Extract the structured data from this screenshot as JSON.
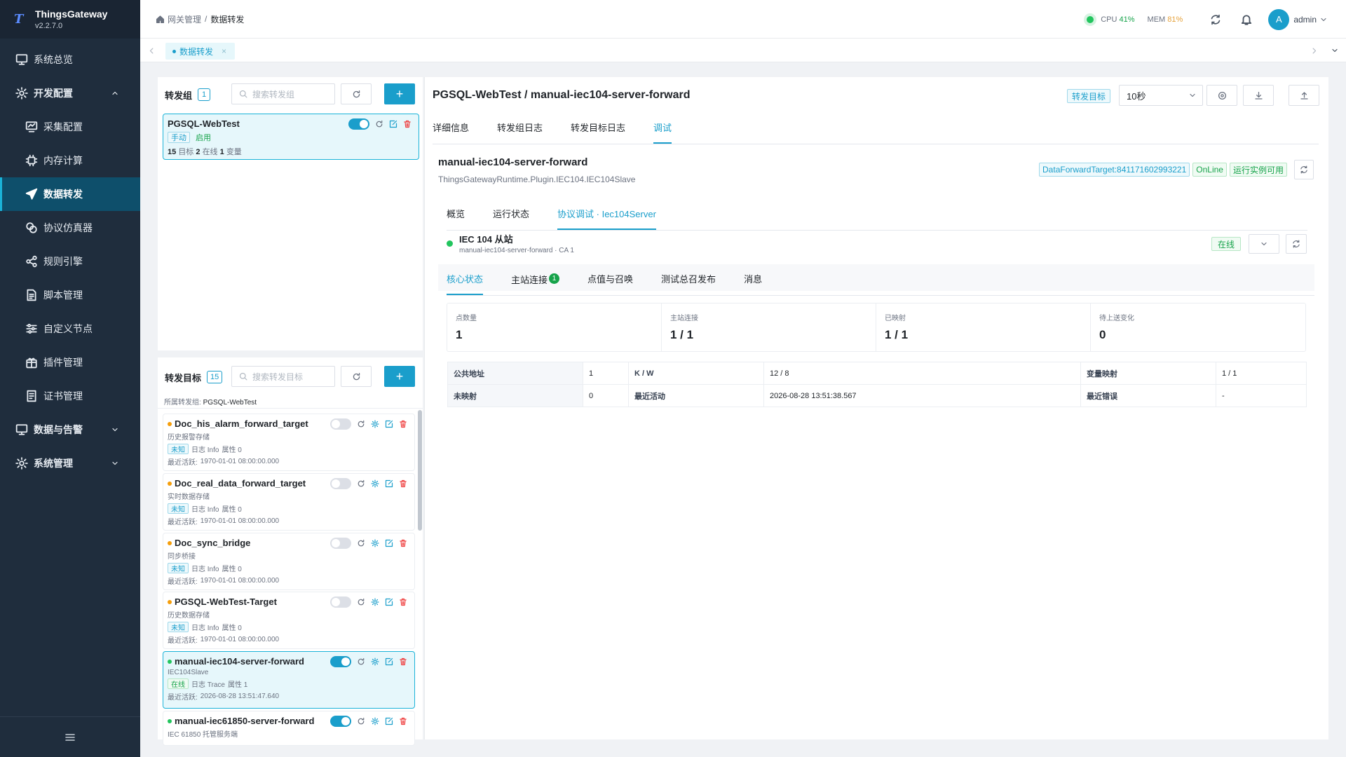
{
  "app": {
    "logo": "T",
    "name": "ThingsGateway",
    "version": "v2.2.7.0"
  },
  "sidebar": {
    "items": [
      {
        "label": "系统总览"
      },
      {
        "label": "开发配置"
      },
      {
        "label": "采集配置"
      },
      {
        "label": "内存计算"
      },
      {
        "label": "数据转发"
      },
      {
        "label": "协议仿真器"
      },
      {
        "label": "规则引擎"
      },
      {
        "label": "脚本管理"
      },
      {
        "label": "自定义节点"
      },
      {
        "label": "插件管理"
      },
      {
        "label": "证书管理"
      },
      {
        "label": "数据与告警"
      },
      {
        "label": "系统管理"
      }
    ]
  },
  "header": {
    "breadcrumb": [
      "网关管理",
      "数据转发"
    ],
    "cpu_label": "CPU",
    "cpu_value": "41%",
    "mem_label": "MEM",
    "mem_value": "81%",
    "user_initial": "A",
    "user_name": "admin"
  },
  "tabs": [
    {
      "label": "数据转发",
      "close": "×"
    }
  ],
  "groups": {
    "title": "转发组",
    "count": "1",
    "search_placeholder": "搜索转发组",
    "add_label": "+",
    "card": {
      "name": "PGSQL-WebTest",
      "mode": "手动",
      "state": "启用",
      "s_targets": "15",
      "s_targets_label": "目标",
      "s_online": "2",
      "s_online_label": "在线",
      "s_vars": "1",
      "s_vars_label": "变量"
    }
  },
  "targets": {
    "title": "转发目标",
    "count": "15",
    "search_placeholder": "搜索转发目标",
    "add_label": "+",
    "group_label": "所属转发组:",
    "group_value": "PGSQL-WebTest",
    "items": [
      {
        "name": "Doc_his_alarm_forward_target",
        "desc": "历史报警存储",
        "status": "未知",
        "log": "日志 Info",
        "attr": "属性 0",
        "active_label": "最近活跃:",
        "active": "1970-01-01 08:00:00.000",
        "dot": "#f59e0b"
      },
      {
        "name": "Doc_real_data_forward_target",
        "desc": "实时数据存储",
        "status": "未知",
        "log": "日志 Info",
        "attr": "属性 0",
        "active_label": "最近活跃:",
        "active": "1970-01-01 08:00:00.000",
        "dot": "#f59e0b"
      },
      {
        "name": "Doc_sync_bridge",
        "desc": "同步桥接",
        "status": "未知",
        "log": "日志 Info",
        "attr": "属性 0",
        "active_label": "最近活跃:",
        "active": "1970-01-01 08:00:00.000",
        "dot": "#f59e0b"
      },
      {
        "name": "PGSQL-WebTest-Target",
        "desc": "历史数据存储",
        "status": "未知",
        "log": "日志 Info",
        "attr": "属性 0",
        "active_label": "最近活跃:",
        "active": "1970-01-01 08:00:00.000",
        "dot": "#f59e0b"
      },
      {
        "name": "manual-iec104-server-forward",
        "desc": "IEC104Slave",
        "status": "在线",
        "log": "日志 Trace",
        "attr": "属性 1",
        "active_label": "最近活跃:",
        "active": "2026-08-28 13:51:47.640",
        "dot": "#22c55e"
      },
      {
        "name": "manual-iec61850-server-forward",
        "desc": "IEC 61850 托管服务端",
        "dot": "#22c55e"
      }
    ]
  },
  "detail": {
    "title": "PGSQL-WebTest / manual-iec104-server-forward",
    "badge": "转发目标",
    "interval": "10秒",
    "tabs": [
      "详细信息",
      "转发组日志",
      "转发目标日志",
      "调试"
    ],
    "name": "manual-iec104-server-forward",
    "plugin": "ThingsGatewayRuntime.Plugin.IEC104.IEC104Slave",
    "id_tag": "DataForwardTarget:841171602993221",
    "online_tag": "OnLine",
    "runtime_tag": "运行实例可用",
    "subtabs": [
      "概览",
      "运行状态",
      "协议调试 · Iec104Server"
    ],
    "station": {
      "title": "IEC 104 从站",
      "subtitle": "manual-iec104-server-forward · CA 1",
      "status": "在线"
    },
    "core_tabs": [
      "核心状态",
      "主站连接",
      "点值与召唤",
      "测试总召发布",
      "消息"
    ],
    "conn_badge": "1",
    "stats": [
      {
        "label": "点数量",
        "value": "1"
      },
      {
        "label": "主站连接",
        "value": "1 / 1"
      },
      {
        "label": "已映射",
        "value": "1 / 1"
      },
      {
        "label": "待上送变化",
        "value": "0"
      }
    ],
    "kv": {
      "addr_label": "公共地址",
      "addr": "1",
      "kw_label": "K / W",
      "kw": "12 / 8",
      "map_label": "变量映射",
      "map": "1 / 1",
      "unmapped_label": "未映射",
      "unmapped": "0",
      "last_label": "最近活动",
      "last": "2026-08-28 13:51:38.567",
      "err_label": "最近错误",
      "err": "-"
    }
  }
}
